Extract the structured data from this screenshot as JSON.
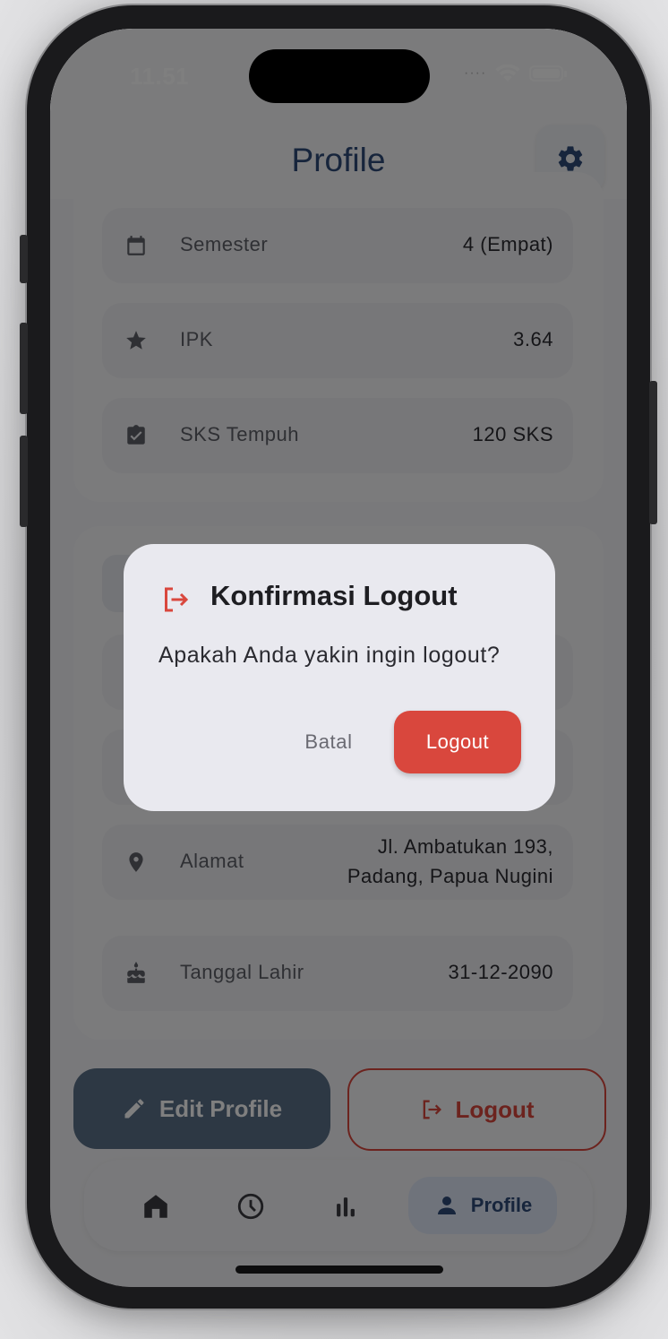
{
  "status_bar": {
    "time": "11.51",
    "signal_dots": "····"
  },
  "header": {
    "title": "Profile",
    "settings_icon": "gear-icon"
  },
  "academic_rows": [
    {
      "label": "Semester",
      "value": "4 (Empat)",
      "icon": "calendar-icon"
    },
    {
      "label": "IPK",
      "value": "3.64",
      "icon": "star-icon"
    },
    {
      "label": "SKS Tempuh",
      "value": "120 SKS",
      "icon": "clipboard-check-icon"
    }
  ],
  "personal_rows": [
    {
      "label": "Alamat",
      "value_line1": "Jl. Ambatukan 193,",
      "value_line2": "Padang, Papua Nugini",
      "icon": "location-pin-icon"
    },
    {
      "label": "Tanggal Lahir",
      "value": "31-12-2090",
      "icon": "cake-icon"
    }
  ],
  "actions": {
    "edit_label": "Edit Profile",
    "logout_label": "Logout"
  },
  "nav": {
    "active_label": "Profile",
    "items": [
      "home-icon",
      "history-icon",
      "stats-icon",
      "person-icon"
    ]
  },
  "dialog": {
    "title": "Konfirmasi Logout",
    "message": "Apakah Anda yakin ingin logout?",
    "cancel_label": "Batal",
    "confirm_label": "Logout"
  },
  "colors": {
    "primary": "#2e4a78",
    "danger": "#d9473d",
    "overlay": "rgba(0,0,0,0.5)"
  }
}
